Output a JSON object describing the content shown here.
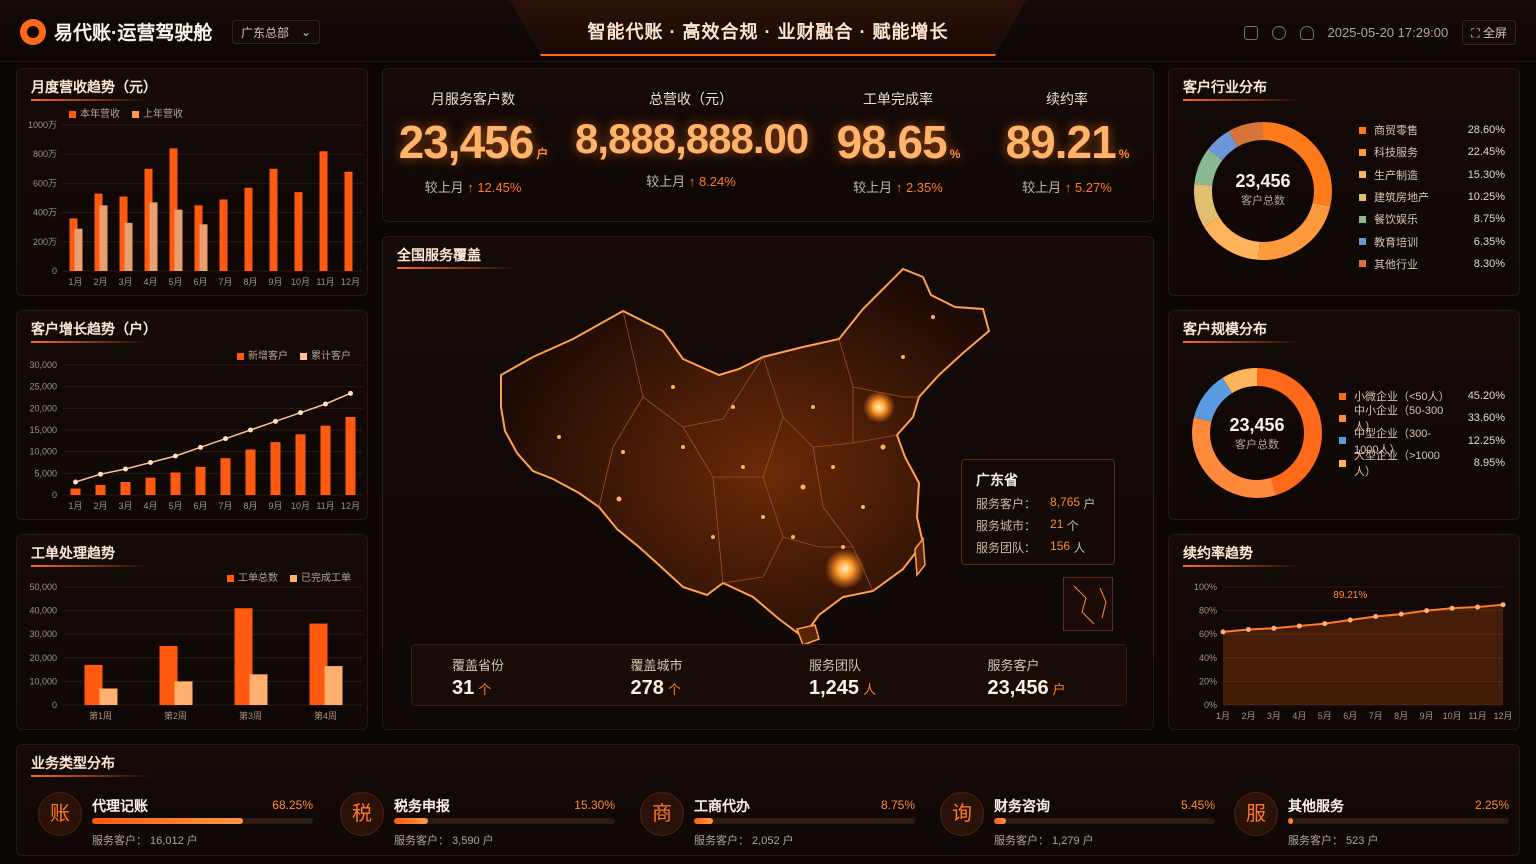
{
  "header": {
    "brand": "易代账·运营驾驶舱",
    "region": "广东总部",
    "slogan": "智能代账 · 高效合规 · 业财融合 · 赋能增长",
    "datetime": "2025-05-20 17:29:00",
    "fullscreen": "全屏",
    "icons": [
      "file-icon",
      "share-icon",
      "cloud-icon"
    ]
  },
  "revenue": {
    "title": "月度营收趋势（元）",
    "legend": [
      "本年营收",
      "上年营收"
    ],
    "chart_data": {
      "type": "bar",
      "categories": [
        "1月",
        "2月",
        "3月",
        "4月",
        "5月",
        "6月",
        "7月",
        "8月",
        "9月",
        "10月",
        "11月",
        "12月"
      ],
      "series": [
        {
          "name": "本年营收",
          "values": [
            360,
            530,
            510,
            700,
            840,
            450,
            490,
            570,
            700,
            540,
            820,
            680
          ]
        },
        {
          "name": "上年营收",
          "values": [
            290,
            450,
            330,
            470,
            420,
            320,
            0,
            0,
            0,
            0,
            0,
            0
          ]
        }
      ],
      "ylim": [
        0,
        1000
      ],
      "yticks": [
        "0",
        "200万",
        "400万",
        "600万",
        "800万",
        "1000万"
      ]
    }
  },
  "growth": {
    "title": "客户增长趋势（户）",
    "legend": [
      "新增客户",
      "累计客户"
    ],
    "chart_data": {
      "type": "bar",
      "categories": [
        "1月",
        "2月",
        "3月",
        "4月",
        "5月",
        "6月",
        "7月",
        "8月",
        "9月",
        "10月",
        "11月",
        "12月"
      ],
      "series": [
        {
          "name": "新增客户",
          "values": [
            1500,
            2300,
            3000,
            4000,
            5200,
            6500,
            8500,
            10500,
            12200,
            14000,
            16000,
            18000
          ]
        },
        {
          "name": "累计客户",
          "values": [
            3000,
            4800,
            6000,
            7500,
            9000,
            11000,
            13000,
            15000,
            17000,
            19000,
            21000,
            23456
          ]
        }
      ],
      "ylim": [
        0,
        30000
      ],
      "yticks": [
        "0",
        "5,000",
        "10,000",
        "15,000",
        "20,000",
        "25,000",
        "30,000"
      ]
    }
  },
  "tickets": {
    "title": "工单处理趋势",
    "legend": [
      "工单总数",
      "已完成工单"
    ],
    "chart_data": {
      "type": "bar",
      "categories": [
        "第1周",
        "第2周",
        "第3周",
        "第4周"
      ],
      "series": [
        {
          "name": "工单总数",
          "values": [
            17000,
            25000,
            41000,
            34500
          ]
        },
        {
          "name": "已完成工单",
          "values": [
            7000,
            10000,
            13000,
            16500
          ]
        }
      ],
      "ylim": [
        0,
        50000
      ],
      "yticks": [
        "0",
        "10,000",
        "20,000",
        "30,000",
        "40,000",
        "50,000"
      ]
    }
  },
  "kpis": [
    {
      "label": "月服务客户数",
      "value": "23,456",
      "unit": "户",
      "cmp_label": "较上月",
      "cmp": "12.45%"
    },
    {
      "label": "总营收（元）",
      "value": "8,888,888.00",
      "unit": "",
      "cmp_label": "较上月",
      "cmp": "8.24%"
    },
    {
      "label": "工单完成率",
      "value": "98.65",
      "unit": "%",
      "cmp_label": "较上月",
      "cmp": "2.35%"
    },
    {
      "label": "续约率",
      "value": "89.21",
      "unit": "%",
      "cmp_label": "较上月",
      "cmp": "5.27%"
    }
  ],
  "map": {
    "title": "全国服务覆盖",
    "province": {
      "name": "广东省",
      "rows": [
        {
          "label": "服务客户：",
          "value": "8,765",
          "unit": "户"
        },
        {
          "label": "服务城市：",
          "value": "21",
          "unit": "个"
        },
        {
          "label": "服务团队：",
          "value": "156",
          "unit": "人"
        }
      ]
    },
    "stats": [
      {
        "label": "覆盖省份",
        "value": "31",
        "unit": "个"
      },
      {
        "label": "覆盖城市",
        "value": "278",
        "unit": "个"
      },
      {
        "label": "服务团队",
        "value": "1,245",
        "unit": "人"
      },
      {
        "label": "服务客户",
        "value": "23,456",
        "unit": "户"
      }
    ]
  },
  "industry": {
    "title": "客户行业分布",
    "center_value": "23,456",
    "center_label": "客户总数",
    "chart_data": {
      "type": "pie",
      "labels": [
        "商贸零售",
        "科技服务",
        "生产制造",
        "建筑房地产",
        "餐饮娱乐",
        "教育培训",
        "其他行业"
      ],
      "values": [
        28.6,
        22.45,
        15.3,
        10.25,
        8.75,
        6.35,
        8.3
      ],
      "pct_text": [
        "28.60%",
        "22.45%",
        "15.30%",
        "10.25%",
        "8.75%",
        "6.35%",
        "8.30%"
      ],
      "colors": [
        "#ff7a1a",
        "#ff9a3c",
        "#ffb35a",
        "#e0c070",
        "#8ab890",
        "#6a98d8",
        "#d8743a"
      ]
    }
  },
  "scale": {
    "title": "客户规模分布",
    "center_value": "23,456",
    "center_label": "客户总数",
    "chart_data": {
      "type": "pie",
      "labels": [
        "小微企业（<50人）",
        "中小企业（50-300人）",
        "中型企业（300-1000人）",
        "大型企业（>1000人）"
      ],
      "values": [
        45.2,
        33.6,
        12.25,
        8.95
      ],
      "pct_text": [
        "45.20%",
        "33.60%",
        "12.25%",
        "8.95%"
      ],
      "colors": [
        "#ff6a1a",
        "#ff8a3c",
        "#5a9ae0",
        "#ffb35a"
      ]
    }
  },
  "renewal": {
    "title": "续约率趋势",
    "chart_data": {
      "type": "area",
      "categories": [
        "1月",
        "2月",
        "3月",
        "4月",
        "5月",
        "6月",
        "7月",
        "8月",
        "9月",
        "10月",
        "11月",
        "12月"
      ],
      "values": [
        62,
        64,
        65,
        67,
        69,
        72,
        75,
        77,
        80,
        82,
        83,
        85
      ],
      "ylim": [
        0,
        100
      ],
      "yticks": [
        "0%",
        "20%",
        "40%",
        "60%",
        "80%",
        "100%"
      ],
      "annotation": "89.21%"
    }
  },
  "business": {
    "title": "业务类型分布",
    "items": [
      {
        "name": "代理记账",
        "pct": "68.25%",
        "fill": 0.6825,
        "sub_label": "服务客户：",
        "customers": "16,012",
        "unit": "户",
        "icon": "ledger-icon",
        "glyph": "账"
      },
      {
        "name": "税务申报",
        "pct": "15.30%",
        "fill": 0.153,
        "sub_label": "服务客户：",
        "customers": "3,590",
        "unit": "户",
        "icon": "tax-icon",
        "glyph": "税"
      },
      {
        "name": "工商代办",
        "pct": "8.75%",
        "fill": 0.0875,
        "sub_label": "服务客户：",
        "customers": "2,052",
        "unit": "户",
        "icon": "building-icon",
        "glyph": "商"
      },
      {
        "name": "财务咨询",
        "pct": "5.45%",
        "fill": 0.0545,
        "sub_label": "服务客户：",
        "customers": "1,279",
        "unit": "户",
        "icon": "team-icon",
        "glyph": "询"
      },
      {
        "name": "其他服务",
        "pct": "2.25%",
        "fill": 0.0225,
        "sub_label": "服务客户：",
        "customers": "523",
        "unit": "户",
        "icon": "service-icon",
        "glyph": "服"
      }
    ]
  }
}
